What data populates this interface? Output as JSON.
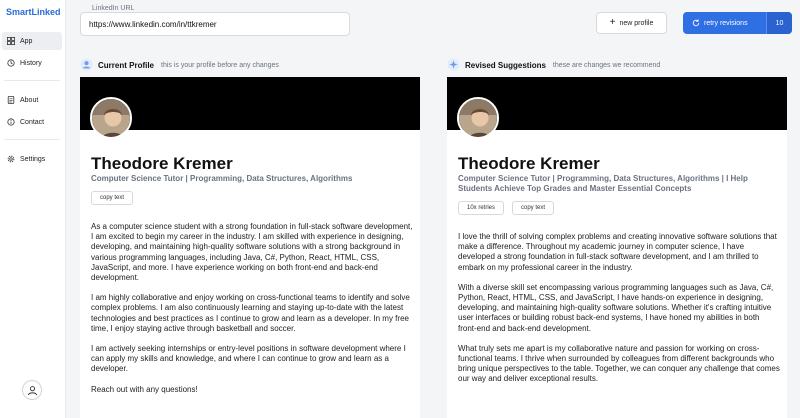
{
  "app": {
    "brand": "SmartLinked"
  },
  "sidebar": {
    "items": [
      {
        "label": "App",
        "icon": "grid-icon"
      },
      {
        "label": "History",
        "icon": "history-icon"
      },
      {
        "label": "About",
        "icon": "document-icon"
      },
      {
        "label": "Contact",
        "icon": "info-icon"
      },
      {
        "label": "Settings",
        "icon": "gear-icon"
      }
    ]
  },
  "top": {
    "url_label": "LinkedIn URL",
    "url_value": "https://www.linkedin.com/in/ttkremer",
    "new_profile": "new profile",
    "retry_label": "retry revisions",
    "retry_count": "10"
  },
  "current": {
    "title": "Current Profile",
    "subtitle": "this is your profile before any changes",
    "name": "Theodore Kremer",
    "headline": "Computer Science Tutor | Programming, Data Structures, Algorithms",
    "copy_label": "copy text",
    "paragraphs": [
      "As a computer science student with a strong foundation in full-stack software development, I am excited to begin my career in the industry. I am skilled with experience in designing, developing, and maintaining high-quality software solutions with a strong background in various programming languages, including Java, C#, Python, React, HTML, CSS, JavaScript, and more. I have experience working on both front-end and back-end development.",
      "I am highly collaborative and enjoy working on cross-functional teams to identify and solve complex problems. I am also continuously learning and staying up-to-date with the latest technologies and best practices as I continue to grow and learn as a developer. In my free time, I enjoy staying active through basketball and soccer.",
      "I am actively seeking internships or entry-level positions in software development where I can apply my skills and knowledge, and where I can continue to grow and learn as a developer.",
      "Reach out with any questions!"
    ]
  },
  "revised": {
    "title": "Revised Suggestions",
    "subtitle": "these are changes we recommend",
    "name": "Theodore Kremer",
    "headline": "Computer Science Tutor | Programming, Data Structures, Algorithms | I Help Students Achieve Top Grades and Master Essential Concepts",
    "retries_label": "10x retries",
    "copy_label": "copy text",
    "paragraphs": [
      "I love the thrill of solving complex problems and creating innovative software solutions that make a difference. Throughout my academic journey in computer science, I have developed a strong foundation in full-stack software development, and I am thrilled to embark on my professional career in the industry.",
      "With a diverse skill set encompassing various programming languages such as Java, C#, Python, React, HTML, CSS, and JavaScript, I have hands-on experience in designing, developing, and maintaining high-quality software solutions. Whether it's crafting intuitive user interfaces or building robust back-end systems, I have honed my abilities in both front-end and back-end development.",
      "What truly sets me apart is my collaborative nature and passion for working on cross-functional teams. I thrive when surrounded by colleagues from different backgrounds who bring unique perspectives to the table. Together, we can conquer any challenge that comes our way and deliver exceptional results."
    ]
  },
  "colors": {
    "accent": "#2f6fe4",
    "banner": "#000000"
  }
}
